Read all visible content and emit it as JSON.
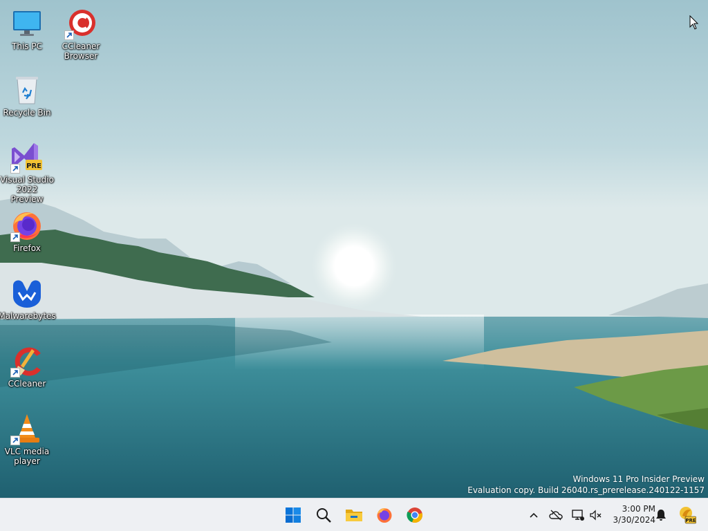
{
  "desktop": {
    "icons": [
      {
        "name": "desktop-icon-this-pc",
        "label": "This PC"
      },
      {
        "name": "desktop-icon-ccleaner-browser",
        "label": "CCleaner\nBrowser"
      },
      {
        "name": "desktop-icon-recycle-bin",
        "label": "Recycle Bin"
      },
      {
        "name": "desktop-icon-visual-studio",
        "label": "Visual Studio\n2022 Preview",
        "badge": "PRE"
      },
      {
        "name": "desktop-icon-firefox",
        "label": "Firefox"
      },
      {
        "name": "desktop-icon-malwarebytes",
        "label": "Malwarebytes"
      },
      {
        "name": "desktop-icon-ccleaner",
        "label": "CCleaner"
      },
      {
        "name": "desktop-icon-vlc",
        "label": "VLC media\nplayer"
      }
    ],
    "watermark": {
      "line1": "Windows 11 Pro Insider Preview",
      "line2": "Evaluation copy. Build 26040.rs_prerelease.240122-1157"
    }
  },
  "taskbar": {
    "pinned": [
      {
        "name": "start-button",
        "icon": "windows-logo-icon"
      },
      {
        "name": "search-button",
        "icon": "search-icon"
      },
      {
        "name": "file-explorer-button",
        "icon": "folder-icon"
      },
      {
        "name": "firefox-taskbar-button",
        "icon": "firefox-icon"
      },
      {
        "name": "chrome-taskbar-button",
        "icon": "chrome-icon"
      }
    ],
    "tray": {
      "icons": [
        "chevron-up-icon",
        "onedrive-offline-icon",
        "network-icon",
        "volume-muted-icon",
        "bell-icon",
        "insider-pre-icon"
      ],
      "insider_badge": "PRE"
    },
    "clock": {
      "time": "3:00 PM",
      "date": "3/30/2024"
    }
  },
  "colors": {
    "accent": "#0078d4",
    "taskbar_bg": "#eef0f3",
    "sky_top": "#9ec2cc",
    "water": "#2f7f8f"
  }
}
